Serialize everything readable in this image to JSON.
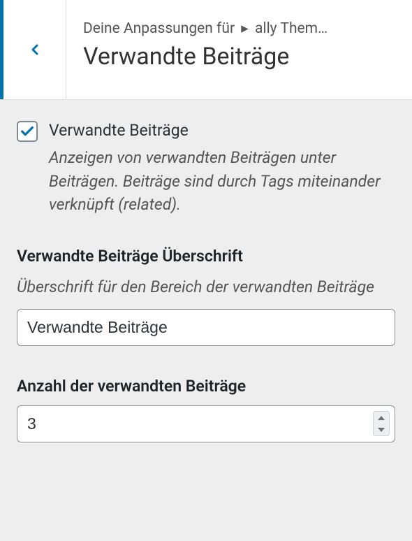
{
  "header": {
    "breadcrumb_prefix": "Deine Anpassungen für",
    "breadcrumb_theme": "ally Them…",
    "title": "Verwandte Beiträge"
  },
  "controls": {
    "related_posts": {
      "checked": true,
      "label": "Verwandte Beiträge",
      "description": "Anzeigen von verwandten Beiträgen unter Beiträgen. Beiträge sind durch Tags miteinander verknüpft (related)."
    },
    "heading": {
      "title": "Verwandte Beiträge Überschrift",
      "description": "Überschrift für den Bereich der verwandten Beiträge",
      "value": "Verwandte Beiträge"
    },
    "count": {
      "title": "Anzahl der verwandten Beiträge",
      "value": "3"
    }
  },
  "colors": {
    "accent": "#0073aa"
  }
}
